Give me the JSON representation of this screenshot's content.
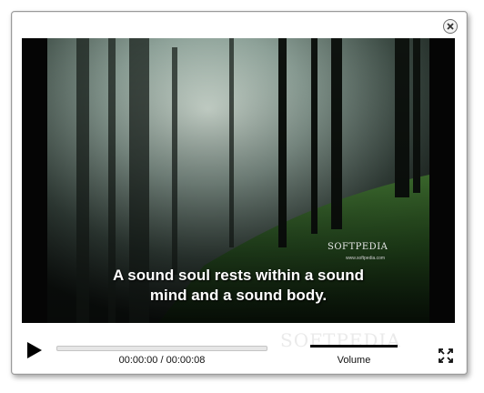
{
  "window": {
    "close_icon": "close-icon"
  },
  "video": {
    "subtitle_lines": [
      "A sound soul rests within a sound",
      "mind and a sound body."
    ],
    "watermark_brand": "SOFTPEDIA",
    "watermark_url": "www.softpedia.com"
  },
  "controls": {
    "play_icon": "play-icon",
    "time_display": "00:00:00 / 00:00:08",
    "progress_fraction": 0,
    "volume_label": "Volume",
    "volume_level": 1.0,
    "fullscreen_icon": "fullscreen-icon",
    "background_watermark": "SOFTPEDIA"
  },
  "colors": {
    "video_background": "#050505",
    "subtitle_text": "#ffffff",
    "volume_fill": "#000000"
  }
}
